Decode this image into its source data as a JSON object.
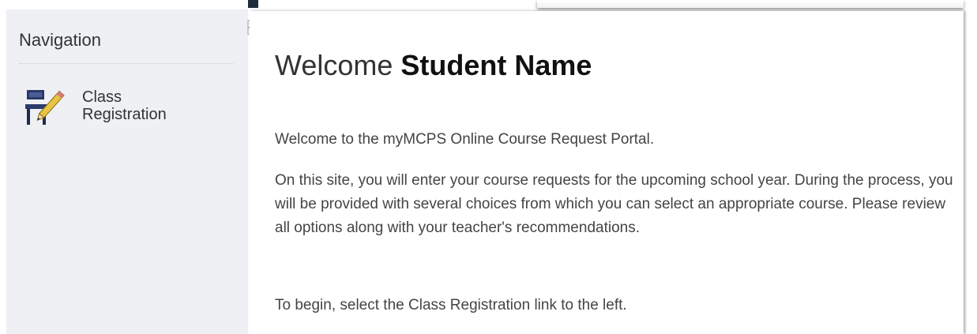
{
  "sidebar": {
    "heading": "Navigation",
    "items": [
      {
        "label": "Class Registration",
        "icon": "desk-pencil-icon"
      }
    ]
  },
  "main": {
    "title_prefix": "Welcome",
    "title_name": "Student Name",
    "intro": "Welcome to the myMCPS Online Course Request Portal.",
    "paragraph": "On this site, you will enter your course requests for the upcoming school year. During the process, you will be provided with several choices from which you can select an appropriate course. Please review all options along with your teacher's recommendations.",
    "instruction": "To begin, select the Class Registration link to the left."
  },
  "colors": {
    "sidebar_bg": "#eef0f4",
    "text": "#444444",
    "heading": "#333333",
    "icon_blue": "#2b3a6b",
    "icon_yellow": "#e8c442"
  }
}
